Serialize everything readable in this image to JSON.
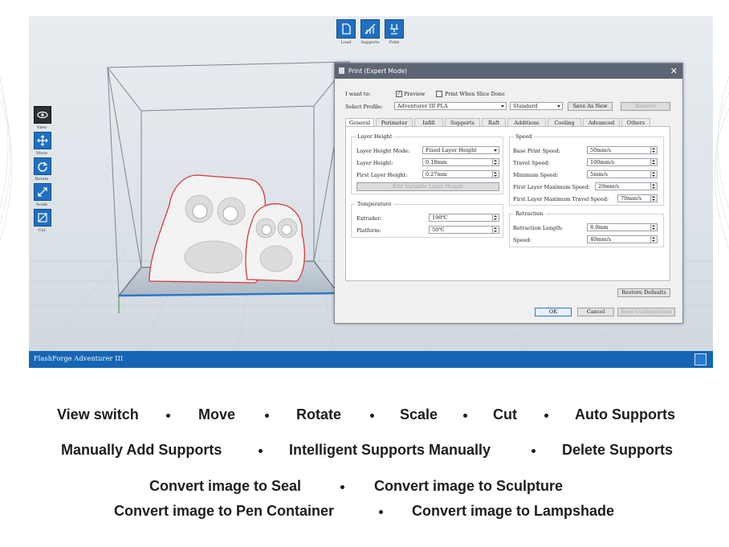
{
  "toolbar_top": [
    {
      "label": "Load",
      "icon": "load-icon"
    },
    {
      "label": "Supports",
      "icon": "supports-icon"
    },
    {
      "label": "Print",
      "icon": "print-icon"
    }
  ],
  "toolbar_left": [
    {
      "label": "View",
      "icon": "eye-icon"
    },
    {
      "label": "Move",
      "icon": "move-icon"
    },
    {
      "label": "Rotate",
      "icon": "rotate-icon"
    },
    {
      "label": "Scale",
      "icon": "scale-icon"
    },
    {
      "label": "Cut",
      "icon": "cut-icon"
    }
  ],
  "status_bar": {
    "printer_name": "FlashForge Adventurer III"
  },
  "dialog": {
    "title": "Print (Expert Mode)",
    "i_want_to_label": "I want to:",
    "preview_label": "Preview",
    "preview_checked": true,
    "print_when_slice_done_label": "Print When Slice Done",
    "print_when_slice_done_checked": false,
    "select_profile_label": "Select Profile:",
    "profile_value": "Adventurer III PLA",
    "quality_value": "Standard",
    "save_as_new_label": "Save As New",
    "remove_label": "Remove",
    "tabs": [
      "General",
      "Perimeter",
      "Infill",
      "Supports",
      "Raft",
      "Additions",
      "Cooling",
      "Advanced",
      "Others"
    ],
    "active_tab": "General",
    "layer_height_group": {
      "title": "Layer Height",
      "mode_label": "Layer Height Mode:",
      "mode_value": "Fixed Layer Height",
      "layer_height_label": "Layer Height:",
      "layer_height_value": "0.18mm",
      "first_layer_height_label": "First Layer Height:",
      "first_layer_height_value": "0.27mm",
      "edit_variable_label": "Edit Variable Layer Height"
    },
    "temperature_group": {
      "title": "Temperature",
      "extruder_label": "Extruder:",
      "extruder_value": "190℃",
      "platform_label": "Platform:",
      "platform_value": "50℃"
    },
    "speed_group": {
      "title": "Speed",
      "base_print_speed_label": "Base Print Speed:",
      "base_print_speed_value": "50mm/s",
      "travel_speed_label": "Travel Speed:",
      "travel_speed_value": "100mm/s",
      "minimum_speed_label": "Minimum Speed:",
      "minimum_speed_value": "5mm/s",
      "first_layer_max_speed_label": "First Layer Maximum Speed:",
      "first_layer_max_speed_value": "20mm/s",
      "first_layer_max_travel_speed_label": "First Layer Maximum Travel Speed:",
      "first_layer_max_travel_speed_value": "70mm/s"
    },
    "retraction_group": {
      "title": "Retraction",
      "retraction_length_label": "Retraction Length:",
      "retraction_length_value": "8.0mm",
      "speed_label": "Speed:",
      "speed_value": "40mm/s"
    },
    "restore_defaults_label": "Restore Defaults",
    "ok_label": "OK",
    "cancel_label": "Cancel",
    "save_configuration_label": "Save Configuration"
  },
  "features": {
    "row1": [
      "View switch",
      "Move",
      "Rotate",
      "Scale",
      "Cut",
      "Auto Supports"
    ],
    "row2": [
      "Manually Add Supports",
      "Intelligent Supports Manually",
      "Delete Supports"
    ],
    "row3": [
      "Convert image to Seal",
      "Convert image to Sculpture"
    ],
    "row4": [
      "Convert image to Pen Container",
      "Convert image to Lampshade"
    ]
  },
  "colors": {
    "accent": "#1f6fc1",
    "status_bar": "#1565b4",
    "model_outline": "#d9383a",
    "dialog_title": "#5c6672"
  }
}
